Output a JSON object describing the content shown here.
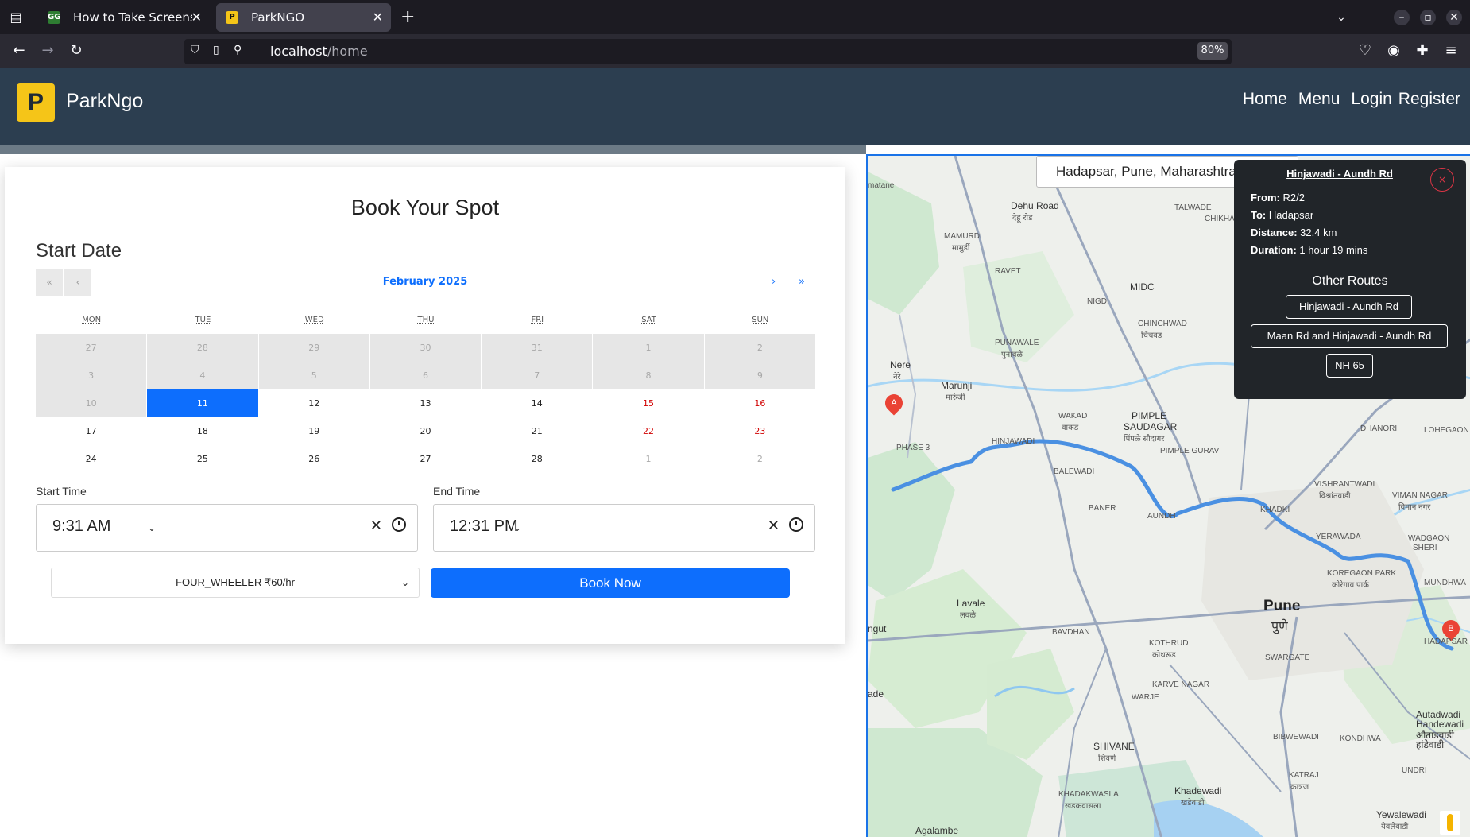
{
  "browser": {
    "tabs": [
      {
        "title": "How to Take Screenshots",
        "favicon": "GG"
      },
      {
        "title": "ParkNGO",
        "favicon": "P"
      }
    ],
    "url_host": "localhost",
    "url_path": "/home",
    "zoom": "80%"
  },
  "header": {
    "logo_letter": "P",
    "brand": "ParkNgo",
    "nav": [
      "Home",
      "Menu",
      "Login",
      "Register"
    ]
  },
  "booking": {
    "title": "Book Your Spot",
    "start_date_label": "Start Date",
    "calendar": {
      "month": "February 2025",
      "prev_year": "«",
      "prev_month": "‹",
      "next_month": "›",
      "next_year": "»",
      "weekdays": [
        "MON",
        "TUE",
        "WED",
        "THU",
        "FRI",
        "SAT",
        "SUN"
      ],
      "weeks": [
        [
          "27",
          "28",
          "29",
          "30",
          "31",
          "1",
          "2"
        ],
        [
          "3",
          "4",
          "5",
          "6",
          "7",
          "8",
          "9"
        ],
        [
          "10",
          "11",
          "12",
          "13",
          "14",
          "15",
          "16"
        ],
        [
          "17",
          "18",
          "19",
          "20",
          "21",
          "22",
          "23"
        ],
        [
          "24",
          "25",
          "26",
          "27",
          "28",
          "1",
          "2"
        ]
      ],
      "selected": "11"
    },
    "start_time_label": "Start Time",
    "start_time": "9:31 AM",
    "end_time_label": "End Time",
    "end_time": "12:31 PM",
    "vehicle": "FOUR_WHEELER ₹60/hr",
    "book_button": "Book Now"
  },
  "map": {
    "search_value": "Hadapsar, Pune, Maharashtra",
    "marker_a": "A",
    "marker_b": "B",
    "labels": {
      "matane": "matane",
      "dehu": "Dehu Road",
      "dehu2": "देहू रोड",
      "talwade": "TALWADE",
      "chikhali": "CHIKHALI",
      "mamurdi": "MAMURDI",
      "mamurdi2": "मामुर्डी",
      "ravet": "RAVET",
      "midc": "MIDC",
      "nigdi": "NIGDI",
      "chinchwad": "CHINCHWAD",
      "chinchwad2": "चिंचवड",
      "punawale": "PUNAWALE",
      "punawale2": "पुनावळे",
      "nere": "Nere",
      "nere2": "नेरे",
      "marunji": "Marunji",
      "marunji2": "मारुंजी",
      "wakad": "WAKAD",
      "wakad2": "वाकड",
      "pimple": "PIMPLE",
      "saudagar": "SAUDAGAR",
      "saudagar2": "पिंपळे सौदागर",
      "pimplegurav": "PIMPLE GURAV",
      "phase3": "PHASE 3",
      "hinjawadi": "HINJAWADI",
      "balewadi": "BALEWADI",
      "baner": "BANER",
      "aundh": "AUNDH",
      "khadki": "KHADKI",
      "vishrantwadi": "VISHRANTWADI",
      "vishrantwadi2": "विश्रांतवाडी",
      "vimannagar": "VIMAN NAGAR",
      "vimannagar2": "विमान नगर",
      "yerawada": "YERAWADA",
      "koregaon": "KOREGAON PARK",
      "koregaon2": "कोरेगाव पार्क",
      "wadgaon": "WADGAON",
      "sheri": "SHERI",
      "lohegaon": "LOHEGAON",
      "dhanori": "DHANORI",
      "pune": "Pune",
      "pune2": "पुणे",
      "swargate": "SWARGATE",
      "kothrud": "KOTHRUD",
      "kothrud2": "कोथरूड",
      "bavdhan": "BAVDHAN",
      "lavale": "Lavale",
      "lavale2": "लवळे",
      "ungut": "ngut",
      "ade": "ade",
      "karvenagar": "KARVE NAGAR",
      "warje": "WARJE",
      "hadapsar": "HADAPSAR",
      "mundhwa": "MUNDHWA",
      "autadwadi": "Autadwadi",
      "handewadi": "Handewadi",
      "autadwadi2": "औताडवाडी",
      "handewadi2": "हांडेवाडी",
      "bibwewadi": "BIBWEWADI",
      "kondhwa": "KONDHWA",
      "shivane": "SHIVANE",
      "shivane2": "शिवणे",
      "katraj": "KATRAJ",
      "katraj2": "कात्रज",
      "khadakwasla": "KHADAKWASLA",
      "khadakwasla2": "खडकवासला",
      "khadewadi": "Khadewadi",
      "khadewadi2": "खडेवाडी",
      "undri": "UNDRI",
      "yewalewadi": "Yewalewadi",
      "yewalewadi2": "येवलेवाडी",
      "agalambe": "Agalambe"
    }
  },
  "route": {
    "title": "Hinjawadi - Aundh Rd",
    "close": "×",
    "from_label": "From:",
    "from": "R2/2",
    "to_label": "To:",
    "to": "Hadapsar",
    "distance_label": "Distance:",
    "distance": "32.4 km",
    "duration_label": "Duration:",
    "duration": "1 hour 19 mins",
    "other_routes_title": "Other Routes",
    "other_routes": [
      "Hinjawadi - Aundh Rd",
      "Maan Rd and Hinjawadi - Aundh Rd",
      "NH 65"
    ]
  }
}
